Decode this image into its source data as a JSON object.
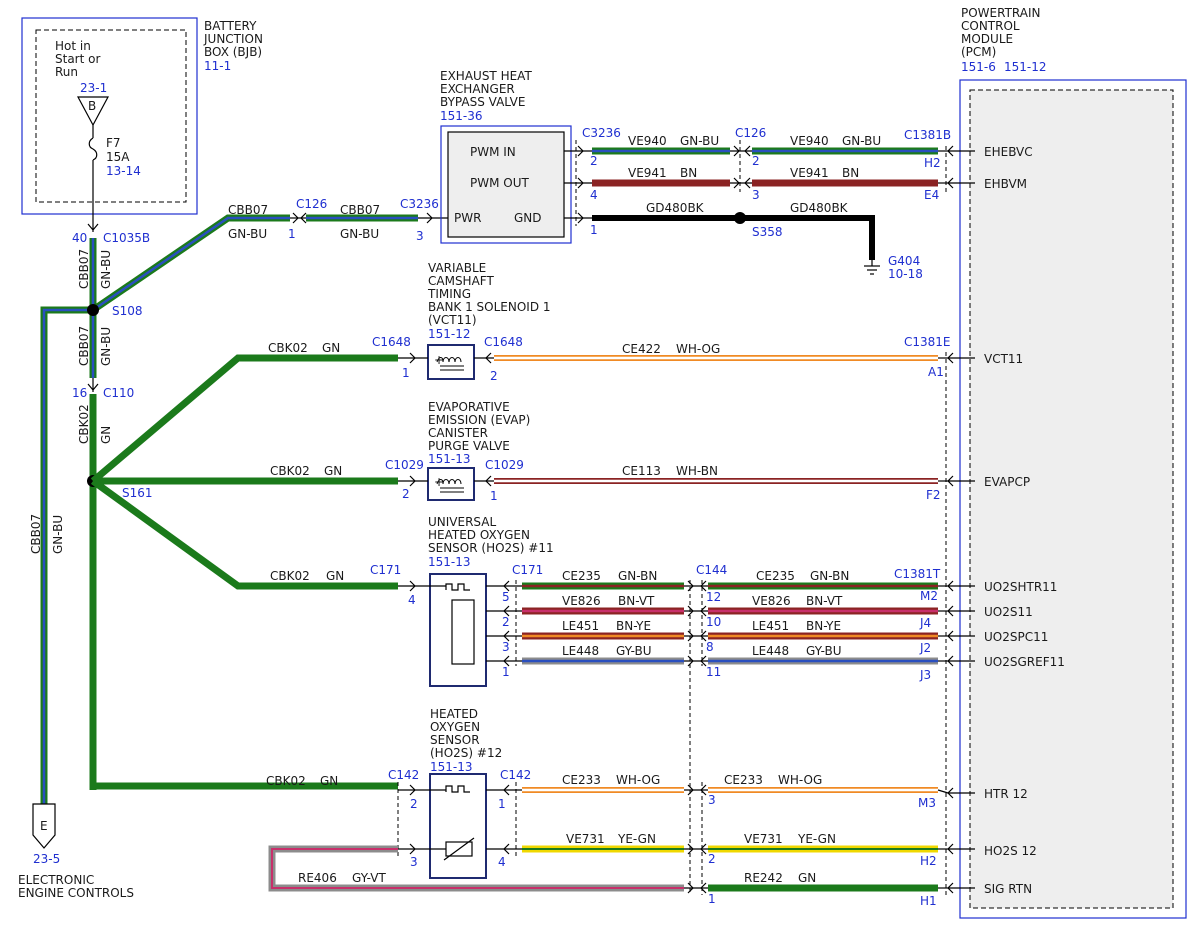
{
  "colors": {
    "ref_blue": "#1f2fd0",
    "GN": "#1b7a1b",
    "BU": "#2a4fbf",
    "BN": "#8b2323",
    "VT": "#c8306b",
    "YE": "#f0d800",
    "OG": "#f08a24",
    "GY": "#8c8c8c",
    "WH": "#ffffff",
    "BK": "#000000",
    "module_fill": "#eeeeee"
  },
  "bjb": {
    "title_lines": [
      "BATTERY",
      "JUNCTION",
      "BOX (BJB)"
    ],
    "ref": "11-1",
    "hot_lines": [
      "Hot in",
      "Start or",
      "Run"
    ],
    "bus_ref": "23-1",
    "bus_letter": "B",
    "fuse_name": "F7",
    "fuse_rating": "15A",
    "fuse_ref": "13-14"
  },
  "pcm": {
    "title_lines": [
      "POWERTRAIN",
      "CONTROL",
      "MODULE",
      "(PCM)"
    ],
    "refs": [
      "151-6",
      "151-12"
    ],
    "pins": [
      "EHEBVC",
      "EHBVM",
      "VCT11",
      "EVAPCP",
      "UO2SHTR11",
      "UO2S11",
      "UO2SPC11",
      "UO2SGREF11",
      "HTR 12",
      "HO2S 12",
      "SIG RTN"
    ]
  },
  "ehbv": {
    "title_lines": [
      "EXHAUST HEAT",
      "EXCHANGER",
      "BYPASS VALVE"
    ],
    "ref": "151-36",
    "terminals": {
      "pwm_in": "PWM IN",
      "pwm_out": "PWM OUT",
      "pwr": "PWR",
      "gnd": "GND"
    }
  },
  "vct": {
    "title_lines": [
      "VARIABLE",
      "CAMSHAFT",
      "TIMING",
      "BANK 1 SOLENOID 1",
      "(VCT11)"
    ],
    "ref": "151-12"
  },
  "evap": {
    "title_lines": [
      "EVAPORATIVE",
      "EMISSION (EVAP)",
      "CANISTER",
      "PURGE VALVE"
    ],
    "ref": "151-13"
  },
  "ho2s11": {
    "title_lines": [
      "UNIVERSAL",
      "HEATED OXYGEN",
      "SENSOR (HO2S) #11"
    ],
    "ref": "151-13"
  },
  "ho2s12": {
    "title_lines": [
      "HEATED",
      "OXYGEN",
      "SENSOR",
      "(HO2S) #12"
    ],
    "ref": "151-13"
  },
  "eec": {
    "letter": "E",
    "ref": "23-5",
    "title_lines": [
      "ELECTRONIC",
      "ENGINE CONTROLS"
    ]
  },
  "ground": {
    "name": "G404",
    "ref": "10-18"
  },
  "splices": [
    "S108",
    "S161",
    "S358"
  ],
  "connectors": {
    "c1035b": "C1035B",
    "c110": "C110",
    "c126": "C126",
    "c3236": "C3236",
    "c1381b": "C1381B",
    "c1648": "C1648",
    "c1381e": "C1381E",
    "c1029": "C1029",
    "c171": "C171",
    "c144": "C144",
    "c1381t": "C1381T",
    "c142": "C142"
  },
  "pins_text": {
    "c1035b": "40",
    "c110": "16",
    "c126_a": "1",
    "c3236_pwr": "3",
    "c3236_in": "2",
    "c126_in": "2",
    "pcm_ehebvc": "H2",
    "c3236_out": "4",
    "c126_out": "3",
    "pcm_ehbvm": "E4",
    "c3236_gnd": "1",
    "c1648_a": "1",
    "c1648_b": "2",
    "pcm_vct": "A1",
    "c1029_a": "2",
    "c1029_b": "1",
    "pcm_evap": "F2",
    "c171_pwr": "4",
    "c171_5": "5",
    "c171_2": "2",
    "c171_3": "3",
    "c171_1": "1",
    "c144_12": "12",
    "c144_10": "10",
    "c144_8": "8",
    "c144_11": "11",
    "pcm_m2": "M2",
    "pcm_j4": "J4",
    "pcm_j2": "J2",
    "pcm_j3": "J3",
    "c142_2": "2",
    "c142_1": "1",
    "c142_3": "3",
    "c142_4": "4",
    "right_3": "3",
    "right_2": "2",
    "right_1": "1",
    "pcm_m3": "M3",
    "pcm_h2b": "H2",
    "pcm_h1": "H1"
  },
  "circuits": {
    "cbb07": "CBB07",
    "gnbu": "GN-BU",
    "cbk02": "CBK02",
    "gn": "GN",
    "ve940": "VE940",
    "ve941": "VE941",
    "bn": "BN",
    "gd480": "GD480BK",
    "ce422": "CE422",
    "whog": "WH-OG",
    "ce113": "CE113",
    "whbn": "WH-BN",
    "ce235": "CE235",
    "gnbn": "GN-BN",
    "ve826": "VE826",
    "bnvt": "BN-VT",
    "le451": "LE451",
    "bnye": "BN-YE",
    "le448": "LE448",
    "gybu": "GY-BU",
    "ce233": "CE233",
    "ve731": "VE731",
    "yegn": "YE-GN",
    "re406": "RE406",
    "gyvt": "GY-VT",
    "re242": "RE242"
  }
}
